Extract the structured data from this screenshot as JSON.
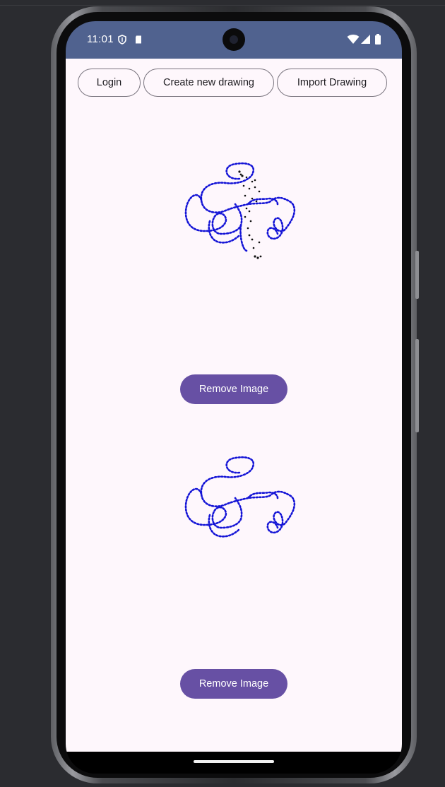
{
  "status_bar": {
    "time": "11:01",
    "left_icons": [
      "shield-icon",
      "sd-card-icon"
    ],
    "right_icons": [
      "wifi-icon",
      "cell-signal-icon",
      "battery-icon"
    ],
    "background_color": "#50628f"
  },
  "toolbar": {
    "login_label": "Login",
    "create_label": "Create new drawing",
    "import_label": "Import Drawing"
  },
  "drawings": [
    {
      "remove_label": "Remove Image",
      "stroke_colors": [
        "#1414d6",
        "#111111"
      ]
    },
    {
      "remove_label": "Remove Image",
      "stroke_colors": [
        "#1414d6"
      ]
    }
  ],
  "colors": {
    "app_background": "#fef7fc",
    "primary": "#6750a4",
    "outline": "#79747e"
  }
}
